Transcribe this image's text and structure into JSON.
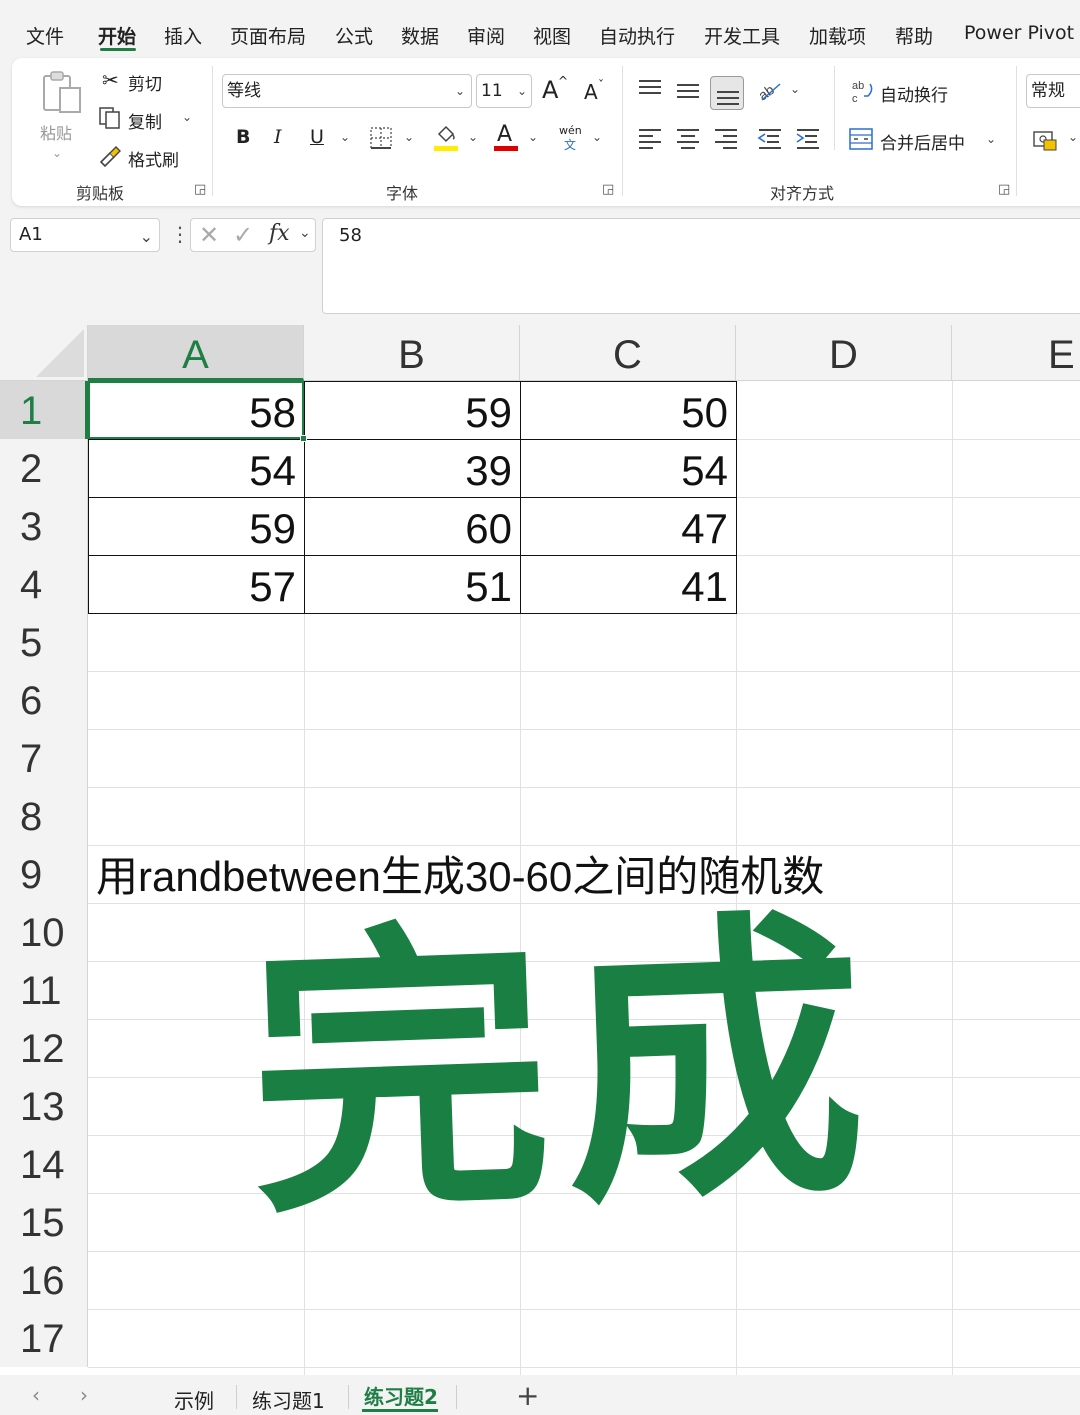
{
  "menu": {
    "tabs": [
      "文件",
      "开始",
      "插入",
      "页面布局",
      "公式",
      "数据",
      "审阅",
      "视图",
      "自动执行",
      "开发工具",
      "加载项",
      "帮助",
      "Power Pivot"
    ],
    "active": "开始"
  },
  "ribbon": {
    "clipboard": {
      "paste": "粘贴",
      "cut": "剪切",
      "copy": "复制",
      "format_painter": "格式刷",
      "group": "剪贴板"
    },
    "font": {
      "name": "等线",
      "size": "11",
      "grow": "A",
      "shrink": "A",
      "bold": "B",
      "italic": "I",
      "underline": "U",
      "font_color_glyph": "A",
      "phonetic_top": "wén",
      "phonetic_bottom": "文",
      "group": "字体",
      "fill_color": "#ffee00",
      "font_color": "#e00000"
    },
    "alignment": {
      "wrap_text": "自动换行",
      "merge_center": "合并后居中",
      "group": "对齐方式"
    },
    "number": {
      "format": "常规"
    }
  },
  "formula_bar": {
    "name_box": "A1",
    "fx": "fx",
    "formula": "58"
  },
  "grid": {
    "columns": [
      "A",
      "B",
      "C",
      "D",
      "E"
    ],
    "rows": [
      "1",
      "2",
      "3",
      "4",
      "5",
      "6",
      "7",
      "8",
      "9",
      "10",
      "11",
      "12",
      "13",
      "14",
      "15",
      "16",
      "17"
    ],
    "table": [
      [
        "58",
        "59",
        "50"
      ],
      [
        "54",
        "39",
        "54"
      ],
      [
        "59",
        "60",
        "47"
      ],
      [
        "57",
        "51",
        "41"
      ]
    ],
    "note": "用randbetween生成30-60之间的随机数",
    "overlay": "完成",
    "accent": "#1e7e44"
  },
  "sheets": {
    "tabs": [
      "示例",
      "练习题1",
      "练习题2"
    ],
    "active": "练习题2",
    "add": "+"
  }
}
